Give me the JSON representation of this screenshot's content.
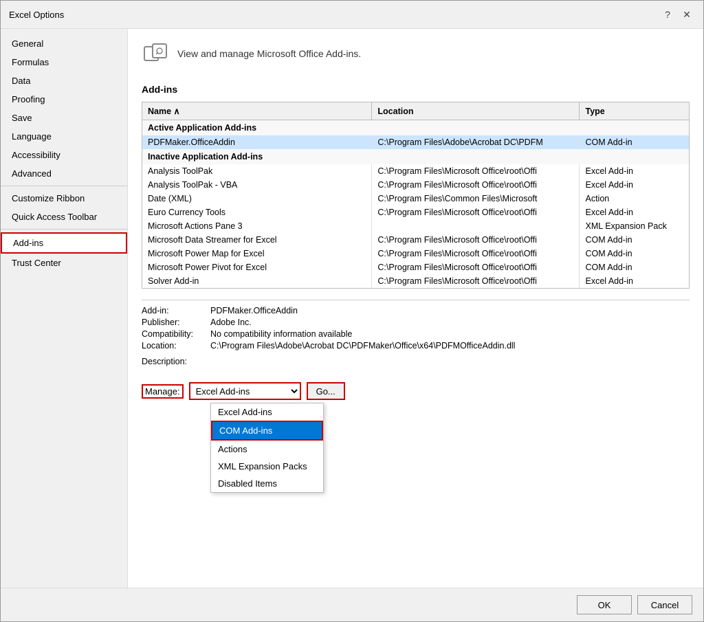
{
  "dialog": {
    "title": "Excel Options",
    "help_btn": "?",
    "close_btn": "✕"
  },
  "sidebar": {
    "items": [
      {
        "id": "general",
        "label": "General"
      },
      {
        "id": "formulas",
        "label": "Formulas"
      },
      {
        "id": "data",
        "label": "Data"
      },
      {
        "id": "proofing",
        "label": "Proofing"
      },
      {
        "id": "save",
        "label": "Save"
      },
      {
        "id": "language",
        "label": "Language"
      },
      {
        "id": "accessibility",
        "label": "Accessibility"
      },
      {
        "id": "advanced",
        "label": "Advanced"
      },
      {
        "id": "customize-ribbon",
        "label": "Customize Ribbon"
      },
      {
        "id": "quick-access",
        "label": "Quick Access Toolbar"
      },
      {
        "id": "addins",
        "label": "Add-ins",
        "active": true
      },
      {
        "id": "trust-center",
        "label": "Trust Center"
      }
    ]
  },
  "main": {
    "page_description": "View and manage Microsoft Office Add-ins.",
    "section_title": "Add-ins",
    "table": {
      "columns": [
        "Name ∧",
        "Location",
        "Type"
      ],
      "sections": [
        {
          "header": "Active Application Add-ins",
          "rows": [
            {
              "name": "PDFMaker.OfficeAddin",
              "location": "C:\\Program Files\\Adobe\\Acrobat DC\\PDFM",
              "type": "COM Add-in",
              "selected": true
            }
          ]
        },
        {
          "header": "Inactive Application Add-ins",
          "rows": [
            {
              "name": "Analysis ToolPak",
              "location": "C:\\Program Files\\Microsoft Office\\root\\Offi",
              "type": "Excel Add-in"
            },
            {
              "name": "Analysis ToolPak - VBA",
              "location": "C:\\Program Files\\Microsoft Office\\root\\Offi",
              "type": "Excel Add-in"
            },
            {
              "name": "Date (XML)",
              "location": "C:\\Program Files\\Common Files\\Microsoft",
              "type": "Action"
            },
            {
              "name": "Euro Currency Tools",
              "location": "C:\\Program Files\\Microsoft Office\\root\\Offi",
              "type": "Excel Add-in"
            },
            {
              "name": "Microsoft Actions Pane 3",
              "location": "",
              "type": "XML Expansion Pack"
            },
            {
              "name": "Microsoft Data Streamer for Excel",
              "location": "C:\\Program Files\\Microsoft Office\\root\\Offi",
              "type": "COM Add-in"
            },
            {
              "name": "Microsoft Power Map for Excel",
              "location": "C:\\Program Files\\Microsoft Office\\root\\Offi",
              "type": "COM Add-in"
            },
            {
              "name": "Microsoft Power Pivot for Excel",
              "location": "C:\\Program Files\\Microsoft Office\\root\\Offi",
              "type": "COM Add-in"
            },
            {
              "name": "Solver Add-in",
              "location": "C:\\Program Files\\Microsoft Office\\root\\Offi",
              "type": "Excel Add-in"
            }
          ]
        }
      ]
    },
    "details": {
      "add_in_label": "Add-in:",
      "add_in_value": "PDFMaker.OfficeAddin",
      "publisher_label": "Publisher:",
      "publisher_value": "Adobe Inc.",
      "compatibility_label": "Compatibility:",
      "compatibility_value": "No compatibility information available",
      "location_label": "Location:",
      "location_value": "C:\\Program Files\\Adobe\\Acrobat DC\\PDFMaker\\Office\\x64\\PDFMOfficeAddin.dll",
      "description_label": "Description:"
    },
    "manage": {
      "label": "Manage:",
      "selected_option": "Excel Add-ins",
      "go_label": "Go...",
      "options": [
        {
          "value": "excel-addins",
          "label": "Excel Add-ins"
        },
        {
          "value": "com-addins",
          "label": "COM Add-ins",
          "highlighted": true
        },
        {
          "value": "actions",
          "label": "Actions"
        },
        {
          "value": "xml-expansion",
          "label": "XML Expansion Packs"
        },
        {
          "value": "disabled",
          "label": "Disabled Items"
        }
      ]
    }
  },
  "footer": {
    "ok_label": "OK",
    "cancel_label": "Cancel"
  }
}
